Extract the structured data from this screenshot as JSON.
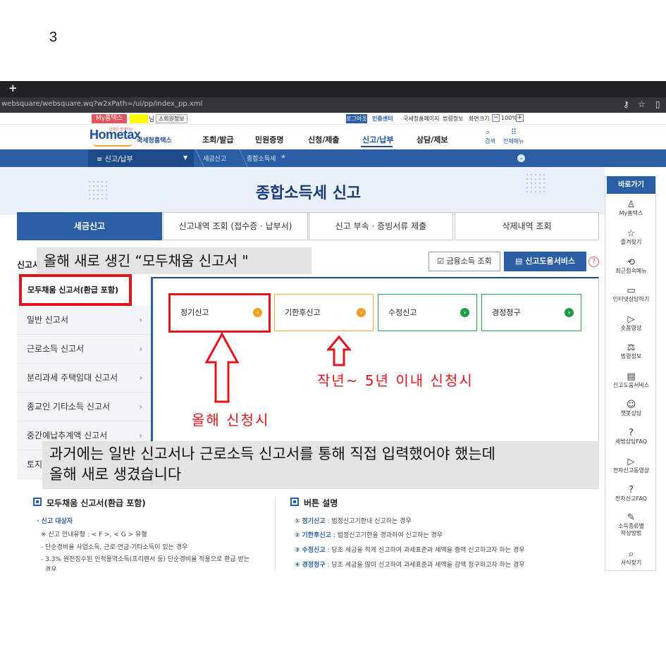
{
  "slide_number": "3",
  "browser": {
    "new_tab": "+",
    "url": "websquare/websquare.wq?w2xPath=/ui/pp/index_pp.xml",
    "icons": [
      "key-icon",
      "star-icon",
      "sidepanel-icon"
    ]
  },
  "utility": {
    "my_hometax": "My홈택스",
    "user_suffix": "님",
    "member_info": "회원정보",
    "logout": "로그아웃",
    "contact_center": "인증센터",
    "links": [
      "국세청홈페이지",
      "법령정보",
      "화면크기"
    ],
    "zoom_minus": "−",
    "zoom_value": "100%",
    "zoom_plus": "+"
  },
  "logo": {
    "main": "Hometax",
    "sub": "국세청홈택스",
    "tag": "언제든 함께하는"
  },
  "gnb": {
    "items": [
      "조회/발급",
      "민원증명",
      "신청/제출",
      "신고/납부",
      "상담/제보"
    ],
    "search": "검색",
    "all_menu": "전체메뉴"
  },
  "location": {
    "current": "신고/납부",
    "crumbs": [
      "세금신고",
      "종합소득세"
    ]
  },
  "page_title": "종합소득세 신고",
  "tabs": [
    "세금신고",
    "신고내역 조회 (접수증 · 납부서)",
    "신고 부속 · 증빙서류 제출",
    "삭제내역 조회"
  ],
  "section_label": "신고서",
  "overlay_top": "올해 새로 생긴 “모두채움 신고서 \"",
  "buttons": {
    "finance": "금융소득 조회",
    "help_service": "신고도움서비스",
    "help_q": "?"
  },
  "side_menu": {
    "active": "모두채움 신고서(환급 포함)",
    "items": [
      "일반 신고서",
      "근로소득 신고서",
      "분리과세 주택임대 신고서",
      "종교인 기타소득 신고서",
      "중간예납추계액 신고서",
      "토지"
    ]
  },
  "options": [
    {
      "label": "정기신고",
      "color": "#f0a020"
    },
    {
      "label": "기한후신고",
      "color": "#f0a020"
    },
    {
      "label": "수정신고",
      "color": "#1f9c45"
    },
    {
      "label": "경정청구",
      "color": "#1f9c45"
    }
  ],
  "annotations": {
    "this_year": "올해 신청시",
    "past_years": "작년~ 5년 이내 신청시",
    "overlay_bottom_1": "과거에는 일반 신고서나 근로소득 신고서를 통해 직접 입력했어야 했는데",
    "overlay_bottom_2": "올해 새로 생겼습니다"
  },
  "info_left": {
    "title": "모두채움 신고서(환급 포함)",
    "target": "· 신고 대상자",
    "type_line": "※ 신고 안내유형 : < F >, < G > 유형",
    "line1": "- 단순경비율 사업소득, 근로·연금·기타소득이 있는 경우",
    "line2": "- 3.3% 원천징수된 인적용역소득(프리랜서 등) 단순경비율 적용으로 환급 받는",
    "line3": "경우"
  },
  "info_right": {
    "title": "버튼 설명",
    "rows": [
      {
        "num": "①",
        "key": "정기신고",
        "desc": " : 법정신고기한내 신고하는 경우"
      },
      {
        "num": "②",
        "key": "기한후신고",
        "desc": " : 법정신고기한을 경과하여 신고하는 경우"
      },
      {
        "num": "③",
        "key": "수정신고",
        "desc": " : 당초 세금을 적게 신고하여 과세표준과 세액을 증액 신고하고자 하는 경우"
      },
      {
        "num": "④",
        "key": "경정청구",
        "desc": " : 당초 세금을 많이 신고하여 과세표준과 세액을 감액 청구하고자 하는 경우"
      }
    ]
  },
  "quick_menu": {
    "title": "바로가기",
    "items": [
      {
        "icon": "user-icon",
        "glyph": "♙",
        "label": "My홈택스"
      },
      {
        "icon": "star-icon",
        "glyph": "☆",
        "label": "즐겨찾기"
      },
      {
        "icon": "history-icon",
        "glyph": "⟲",
        "label": "최근접속메뉴"
      },
      {
        "icon": "monitor-icon",
        "glyph": "▭",
        "label": "인터넷상담하기"
      },
      {
        "icon": "play-icon",
        "glyph": "▷",
        "label": "숏폼영상"
      },
      {
        "icon": "gavel-icon",
        "glyph": "⚖",
        "label": "법령정보"
      },
      {
        "icon": "book-icon",
        "glyph": "▤",
        "label": "신고도움서비스"
      },
      {
        "icon": "chatbot-icon",
        "glyph": "☺",
        "label": "챗봇상담"
      },
      {
        "icon": "faq-icon",
        "glyph": "?",
        "label": "세법상담FAQ"
      },
      {
        "icon": "video-icon",
        "glyph": "▷",
        "label": "전자신고동영상"
      },
      {
        "icon": "faq2-icon",
        "glyph": "?",
        "label": "전자신고FAQ"
      },
      {
        "icon": "form-icon",
        "glyph": "✎",
        "label": "소득종류별"
      },
      {
        "icon": "search-icon",
        "glyph": "⌕",
        "label": "서식찾기"
      }
    ],
    "form_label_2": "작성방법"
  }
}
